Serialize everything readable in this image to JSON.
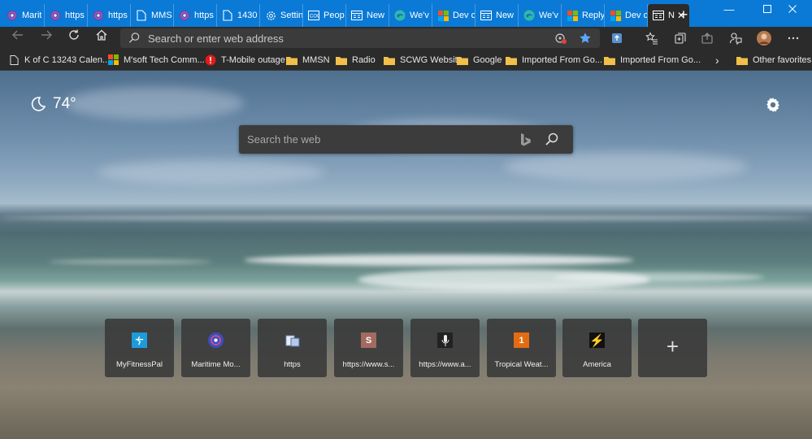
{
  "window": {
    "minimize": "—",
    "maximize": "☐",
    "close": "✕"
  },
  "tabs": [
    {
      "label": "Marit",
      "icon": "maritime-logo-icon"
    },
    {
      "label": "https",
      "icon": "maritime-logo-icon"
    },
    {
      "label": "https",
      "icon": "maritime-logo-icon"
    },
    {
      "label": "MMS",
      "icon": "page-icon"
    },
    {
      "label": "https",
      "icon": "maritime-logo-icon"
    },
    {
      "label": "1430",
      "icon": "page-icon"
    },
    {
      "label": "Settin",
      "icon": "gear-icon"
    },
    {
      "label": "Peop",
      "icon": "people-icon"
    },
    {
      "label": "New",
      "icon": "newtab-icon"
    },
    {
      "label": "We'v",
      "icon": "edge-icon"
    },
    {
      "label": "Dev c",
      "icon": "microsoft-icon"
    },
    {
      "label": "New",
      "icon": "newtab-icon"
    },
    {
      "label": "We'v",
      "icon": "edge-icon"
    },
    {
      "label": "Reply",
      "icon": "microsoft-icon"
    },
    {
      "label": "Dev c",
      "icon": "microsoft-icon"
    },
    {
      "label": "N",
      "icon": "newtab-icon",
      "active": true
    }
  ],
  "newtab_label": "+",
  "address": {
    "placeholder": "Search or enter web address"
  },
  "toolbar_icons": [
    "tracking-icon",
    "favorite-star-icon",
    "extension-icon",
    "favorites-list-icon",
    "collections-icon",
    "share-icon",
    "feedback-icon",
    "profile-avatar",
    "more-menu-icon"
  ],
  "favorites": [
    {
      "label": "K of C 13243 Calen...",
      "icon": "page-icon"
    },
    {
      "label": "M'soft Tech Comm...",
      "icon": "microsoft-icon"
    },
    {
      "label": "T-Mobile outage",
      "icon": "alert-icon"
    },
    {
      "label": "MMSN",
      "icon": "folder-icon"
    },
    {
      "label": "Radio",
      "icon": "folder-icon"
    },
    {
      "label": "SCWG Website",
      "icon": "folder-icon"
    },
    {
      "label": "Google",
      "icon": "folder-icon"
    },
    {
      "label": "Imported From Go...",
      "icon": "folder-icon"
    },
    {
      "label": "Imported From Go...",
      "icon": "folder-icon"
    }
  ],
  "favorites_more": "›",
  "other_favorites": "Other favorites",
  "weather": {
    "temperature": "74°",
    "icon": "moon-icon"
  },
  "search": {
    "placeholder": "Search the web"
  },
  "quick_links": [
    {
      "label": "MyFitnessPal",
      "icon_text": "",
      "color": "#1b9cdb"
    },
    {
      "label": "Maritime Mo...",
      "icon_text": "",
      "color": "#3a4ec4"
    },
    {
      "label": "https",
      "icon_text": "",
      "color": "#d0d8e8"
    },
    {
      "label": "https://www.s...",
      "icon_text": "S",
      "color": "#a36a60"
    },
    {
      "label": "https://www.a...",
      "icon_text": "",
      "color": "#222222"
    },
    {
      "label": "Tropical Weat...",
      "icon_text": "1",
      "color": "#e36c13"
    },
    {
      "label": "America",
      "icon_text": "⚡",
      "color": "#111111"
    }
  ],
  "add_tile_label": "+",
  "colors": {
    "titlebar": "#0a7ad6",
    "toolbar": "#2b2b2b"
  }
}
